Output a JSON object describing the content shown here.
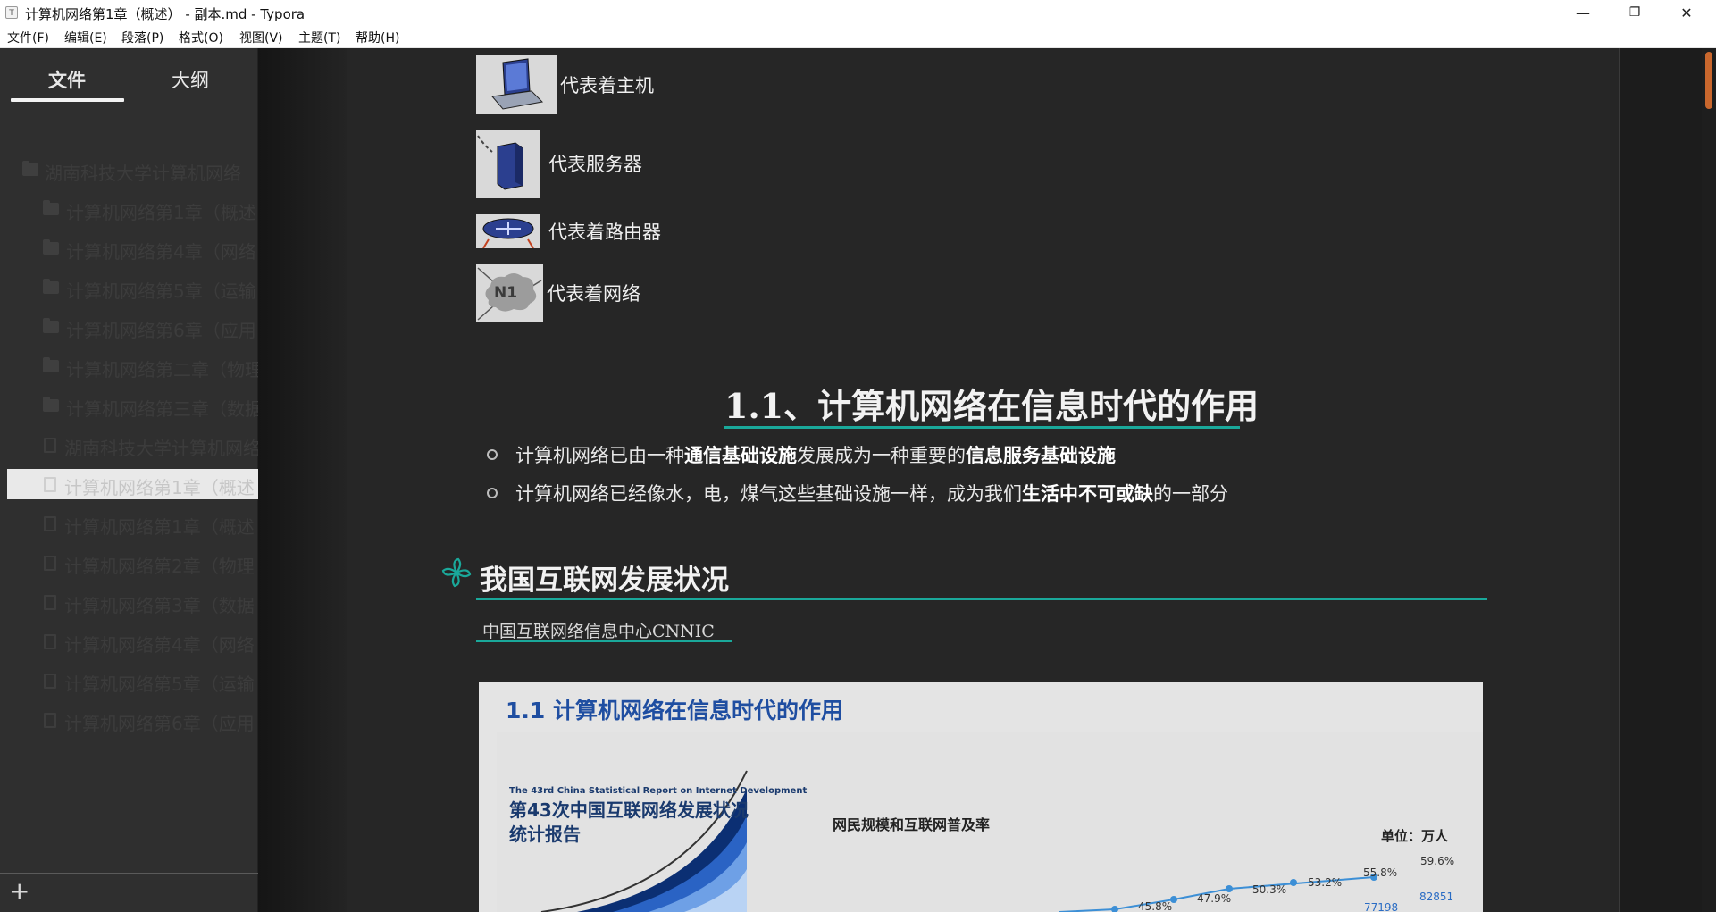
{
  "window": {
    "title": "计算机网络第1章（概述） - 副本.md - Typora",
    "icon_letter": "T",
    "controls": [
      "minimize-icon",
      "restore-icon",
      "close-icon"
    ]
  },
  "menu": [
    "文件(F)",
    "编辑(E)",
    "段落(P)",
    "格式(O)",
    "视图(V)",
    "主题(T)",
    "帮助(H)"
  ],
  "sidebar": {
    "tabs": [
      "文件",
      "大纲"
    ],
    "active_tab": "文件",
    "tree": [
      {
        "label": "湖南科技大学计算机网络",
        "type": "folder"
      },
      {
        "label": "计算机网络第1章（概述",
        "type": "folder"
      },
      {
        "label": "计算机网络第4章（网络",
        "type": "folder"
      },
      {
        "label": "计算机网络第5章（运输",
        "type": "folder"
      },
      {
        "label": "计算机网络第6章（应用",
        "type": "folder"
      },
      {
        "label": "计算机网络第二章（物理",
        "type": "folder"
      },
      {
        "label": "计算机网络第三章（数据",
        "type": "folder"
      },
      {
        "label": "湖南科技大学计算机网络",
        "type": "file"
      },
      {
        "label": "计算机网络第1章（概述",
        "type": "file",
        "active": true
      },
      {
        "label": "计算机网络第1章（概述",
        "type": "file"
      },
      {
        "label": "计算机网络第2章（物理",
        "type": "file"
      },
      {
        "label": "计算机网络第3章（数据",
        "type": "file"
      },
      {
        "label": "计算机网络第4章（网络",
        "type": "file"
      },
      {
        "label": "计算机网络第5章（运输",
        "type": "file"
      },
      {
        "label": "计算机网络第6章（应用",
        "type": "file"
      }
    ],
    "add_button": "+"
  },
  "document": {
    "legend": [
      {
        "icon": "host-laptop-icon",
        "text": "代表着主机"
      },
      {
        "icon": "server-icon",
        "text": "代表服务器"
      },
      {
        "icon": "router-icon",
        "text": "代表着路由器"
      },
      {
        "icon": "network-cloud-icon",
        "text": "代表着网络",
        "badge": "N1"
      }
    ],
    "heading_1_1": "1.1、计算机网络在信息时代的作用",
    "bullets": [
      {
        "pre": "计算机网络已由一种",
        "bold1": "通信基础设施",
        "mid": "发展成为一种重要的",
        "bold2": "信息服务基础设施",
        "post": ""
      },
      {
        "pre": "计算机网络已经像水，电，煤气这些基础设施一样，成为我们",
        "bold1": "生活中不可或缺",
        "mid": "的一部分",
        "bold2": "",
        "post": ""
      }
    ],
    "section_heading": "我国互联网发展状况",
    "link_text": "中国互联网络信息中心CNNIC",
    "slide": {
      "title": "1.1 计算机网络在信息时代的作用",
      "report_en": "The 43rd China Statistical Report on Internet Development",
      "report_cn_line1": "第43次中国互联网络发展状况",
      "report_cn_line2": "统计报告",
      "chart_title": "网民规模和互联网普及率",
      "unit": "单位：万人",
      "rates": [
        "45.8%",
        "47.9%",
        "50.3%",
        "53.2%",
        "55.8%",
        "59.6%"
      ],
      "users_visible": [
        "77198",
        "82851"
      ]
    }
  },
  "colors": {
    "accent": "#1aa89a",
    "sidebar_bg": "#2f2f2f",
    "editor_bg": "#262626",
    "scroll_thumb": "#c9672d"
  }
}
